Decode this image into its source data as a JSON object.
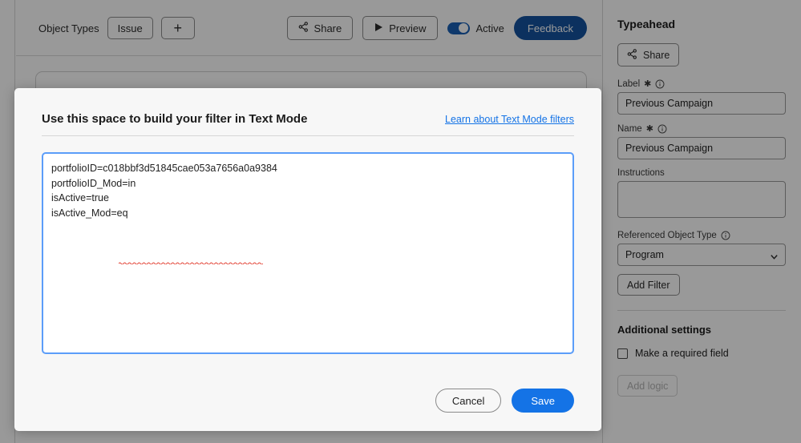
{
  "colors": {
    "accent_blue": "#1473e6",
    "brand_dark_blue": "#14539f",
    "toggle_on": "#1a5fb4",
    "focus_border": "#5b9df9",
    "overlay": "rgba(0,0,0,0.40)"
  },
  "toolbar": {
    "object_types_label": "Object Types",
    "object_type_chip": "Issue",
    "add_object_type": "+",
    "share_label": "Share",
    "preview_label": "Preview",
    "active_label": "Active",
    "active_state": "on",
    "feedback_label": "Feedback"
  },
  "modal": {
    "title": "Use this space to build your filter in Text Mode",
    "link_label": "Learn about Text Mode filters",
    "filter_text": "portfolioID=c018bbf3d51845cae053a7656a0a9384\nportfolioID_Mod=in\nisActive=true\nisActive_Mod=eq",
    "filter_placeholder": "",
    "cancel_label": "Cancel",
    "save_label": "Save"
  },
  "sidebar": {
    "title": "Typeahead",
    "share_label": "Share",
    "fields": [
      {
        "label": "Label",
        "required": "✱",
        "value": "Previous Campaign",
        "placeholder": ""
      },
      {
        "label": "Name",
        "required": "✱",
        "value": "Previous Campaign",
        "placeholder": ""
      }
    ],
    "instructions_label": "Instructions",
    "instructions_value": "",
    "instructions_placeholder": "",
    "referenced_object_type_label": "Referenced Object Type",
    "referenced_object_type_value": "Program",
    "add_filter_label": "Add Filter",
    "additional_settings_title": "Additional settings",
    "required_field_checkbox_label": "Make a required field",
    "required_field_checked": "false",
    "add_logic_label": "Add logic",
    "add_logic_disabled": "true"
  }
}
